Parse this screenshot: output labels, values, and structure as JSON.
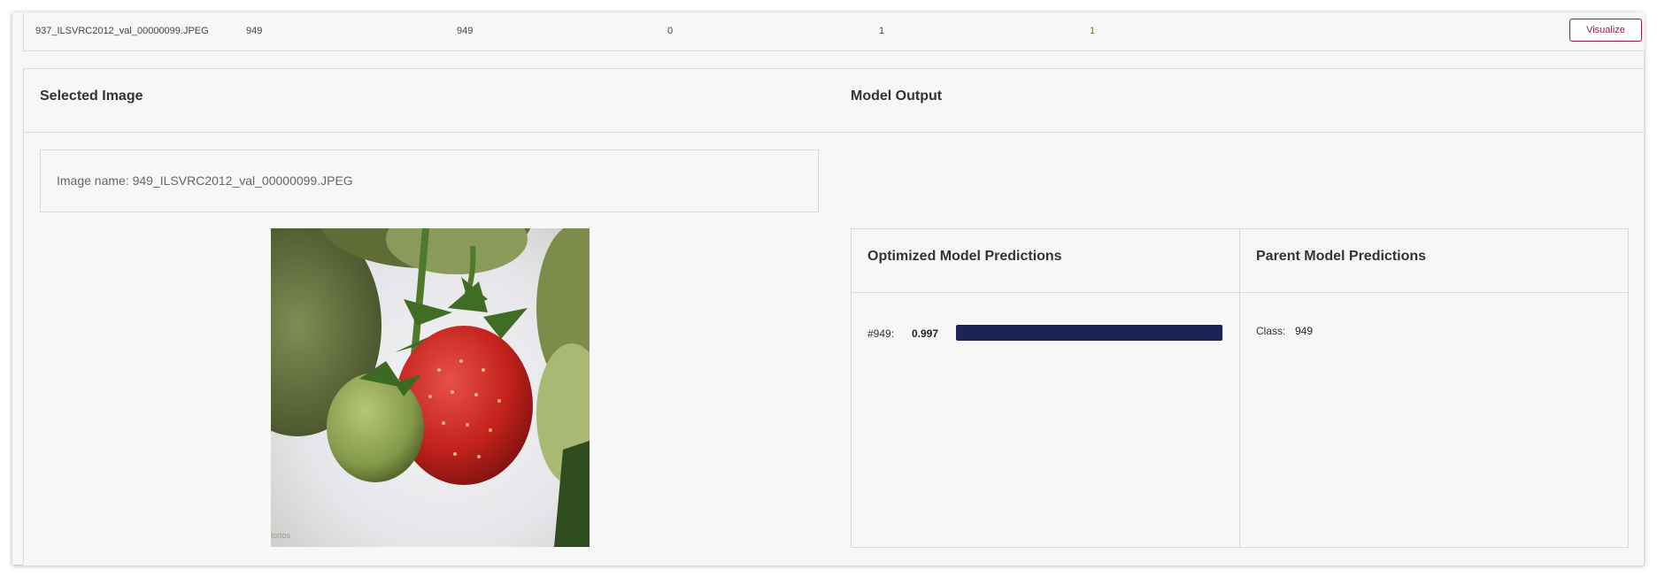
{
  "table_row": {
    "image_name": "937_ILSVRC2012_val_00000099.JPEG",
    "col1": "949",
    "col2": "949",
    "col3": "0",
    "col4": "1",
    "col5": "1",
    "col5_color": "#6b7a1f",
    "visualize_label": "Visualize"
  },
  "selected_image": {
    "title": "Selected Image",
    "image_name_label": "Image name: 949_ILSVRC2012_val_00000099.JPEG",
    "watermark": "lortos"
  },
  "model_output": {
    "title": "Model Output",
    "optimized": {
      "title": "Optimized Model Predictions",
      "predictions": [
        {
          "label": "#949:",
          "value": "0.997",
          "fraction": 0.997
        }
      ]
    },
    "parent": {
      "title": "Parent Model Predictions",
      "class_label": "Class:",
      "class_value": "949"
    }
  },
  "colors": {
    "accent": "#8a1f47",
    "bar": "#1d2353"
  }
}
